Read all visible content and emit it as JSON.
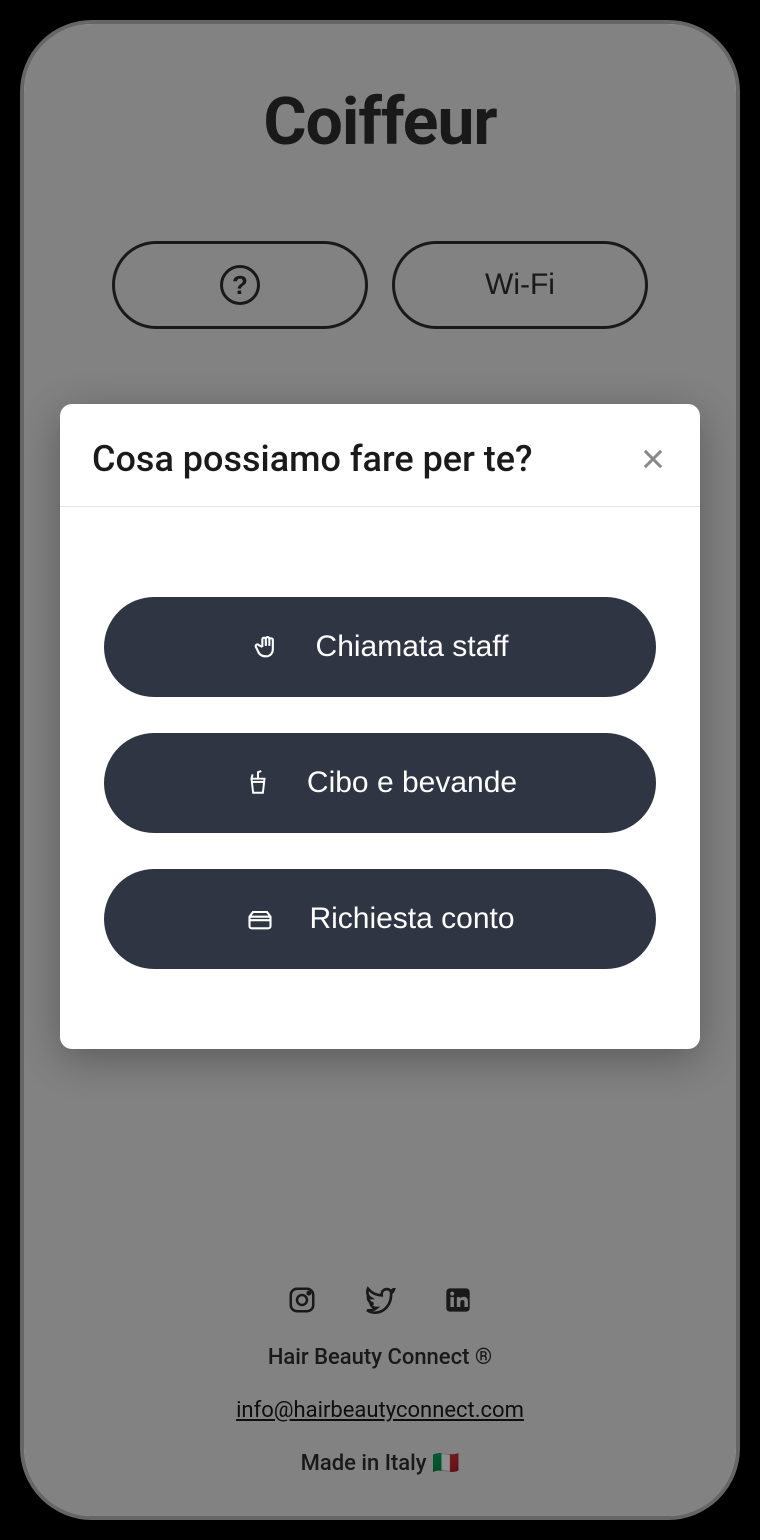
{
  "header": {
    "title": "Coiffeur"
  },
  "pills": {
    "help_label": "?",
    "wifi_label": "Wi-Fi"
  },
  "modal": {
    "title": "Cosa possiamo fare per te?",
    "buttons": [
      {
        "icon": "hand-icon",
        "label": "Chiamata staff"
      },
      {
        "icon": "cup-icon",
        "label": "Cibo e bevande"
      },
      {
        "icon": "card-icon",
        "label": "Richiesta conto"
      }
    ]
  },
  "footer": {
    "brand": "Hair Beauty Connect ®",
    "email": "info@hairbeautyconnect.com",
    "made_in": "Made in Italy 🇮🇹"
  }
}
